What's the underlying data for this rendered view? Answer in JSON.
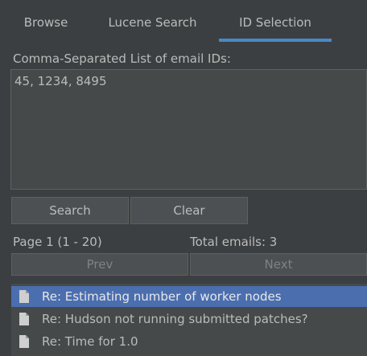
{
  "tabs": [
    "Browse",
    "Lucene Search",
    "ID Selection"
  ],
  "active_tab": "ID Selection",
  "id_selection": {
    "label": "Comma-Separated List of email IDs:",
    "value": "45, 1234, 8495"
  },
  "buttons": {
    "search": "Search",
    "clear": "Clear",
    "prev": "Prev",
    "next": "Next"
  },
  "pagination": {
    "page": "Page 1 (1 - 20)",
    "total": "Total emails: 3"
  },
  "results": [
    {
      "subject": "Re: Estimating number of worker nodes",
      "icon": "document-icon"
    },
    {
      "subject": "Re: Hudson not running submitted patches?",
      "icon": "document-icon"
    },
    {
      "subject": "Re: Time for 1.0",
      "icon": "document-icon"
    }
  ],
  "colors": {
    "background": "#3c3f41",
    "accent": "#4a88c7",
    "selection": "#4b6eaf"
  }
}
